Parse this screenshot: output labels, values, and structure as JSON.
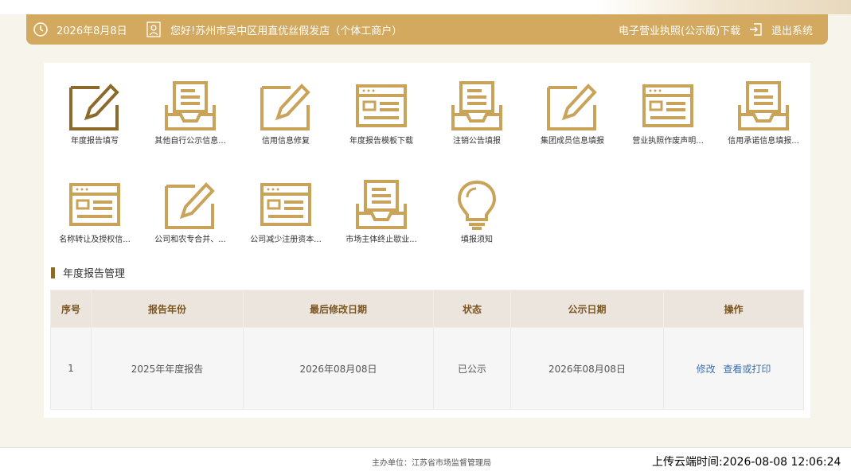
{
  "header": {
    "date": "2026年8月8日",
    "greeting": "您好!苏州市吴中区用直优丝假发店（个体工商户）",
    "license_download": "电子营业执照(公示版)下载",
    "logout": "退出系统"
  },
  "menu_row1": [
    {
      "label": "年度报告填写",
      "icon": "edit-icon"
    },
    {
      "label": "其他自行公示信息...",
      "icon": "inbox-icon"
    },
    {
      "label": "信用信息修复",
      "icon": "edit-icon"
    },
    {
      "label": "年度报告模板下载",
      "icon": "form-window-icon"
    },
    {
      "label": "注销公告填报",
      "icon": "inbox-icon"
    },
    {
      "label": "集团成员信息填报",
      "icon": "edit-icon"
    },
    {
      "label": "营业执照作废声明...",
      "icon": "form-window-icon"
    },
    {
      "label": "信用承诺信息填报...",
      "icon": "inbox-icon"
    }
  ],
  "menu_row2": [
    {
      "label": "名称转让及授权信...",
      "icon": "form-window-icon"
    },
    {
      "label": "公司和农专合并、...",
      "icon": "edit-icon"
    },
    {
      "label": "公司减少注册资本...",
      "icon": "form-window-icon"
    },
    {
      "label": "市场主体终止歇业...",
      "icon": "inbox-icon"
    },
    {
      "label": "填报须知",
      "icon": "lightbulb-icon"
    }
  ],
  "section": {
    "title": "年度报告管理"
  },
  "table": {
    "headers": [
      "序号",
      "报告年份",
      "最后修改日期",
      "状态",
      "公示日期",
      "操作"
    ],
    "rows": [
      {
        "index": "1",
        "year": "2025年年度报告",
        "modified": "2026年08月08日",
        "status": "已公示",
        "published": "2026年08月08日",
        "action_edit": "修改",
        "action_view": "查看或打印"
      }
    ]
  },
  "footer": {
    "org": "主办单位：江苏省市场监督管理局",
    "upload_time": "上传云端时间:2026-08-08 12:06:24"
  },
  "colors": {
    "gold": "#d2a95e",
    "icon_gold": "#c9a35a",
    "icon_dark": "#8b6a2b",
    "link": "#3a6fb0"
  }
}
